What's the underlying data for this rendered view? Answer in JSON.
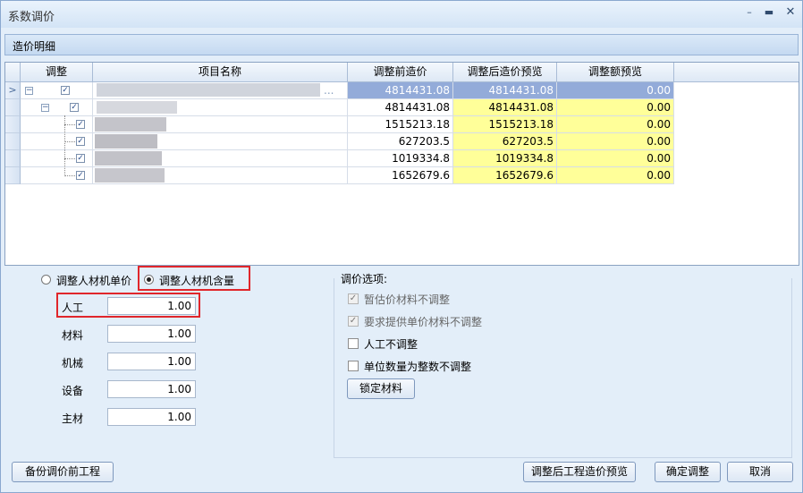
{
  "window": {
    "title": "系数调价"
  },
  "section_header": "造价明细",
  "grid": {
    "columns": [
      "调整",
      "项目名称",
      "调整前造价",
      "调整后造价预览",
      "调整额预览"
    ],
    "rows": [
      {
        "before": "4814431.08",
        "after": "4814431.08",
        "diff": "0.00",
        "name_tail": "..."
      },
      {
        "before": "4814431.08",
        "after": "4814431.08",
        "diff": "0.00"
      },
      {
        "before": "1515213.18",
        "after": "1515213.18",
        "diff": "0.00"
      },
      {
        "before": "627203.5",
        "after": "627203.5",
        "diff": "0.00"
      },
      {
        "before": "1019334.8",
        "after": "1019334.8",
        "diff": "0.00"
      },
      {
        "before": "1652679.6",
        "after": "1652679.6",
        "diff": "0.00"
      }
    ]
  },
  "adjust_mode": {
    "option_unit_price": "调整人材机单价",
    "option_content": "调整人材机含量",
    "selected": "调整人材机含量"
  },
  "coefficients": [
    {
      "label": "人工",
      "value": "1.00"
    },
    {
      "label": "材料",
      "value": "1.00"
    },
    {
      "label": "机械",
      "value": "1.00"
    },
    {
      "label": "设备",
      "value": "1.00"
    },
    {
      "label": "主材",
      "value": "1.00"
    }
  ],
  "options": {
    "title": "调价选项:",
    "items": [
      {
        "label": "暂估价材料不调整",
        "checked": true,
        "disabled": true
      },
      {
        "label": "要求提供单价材料不调整",
        "checked": true,
        "disabled": true
      },
      {
        "label": "人工不调整",
        "checked": false,
        "disabled": false
      },
      {
        "label": "单位数量为整数不调整",
        "checked": false,
        "disabled": false
      }
    ],
    "lock_button": "锁定材料"
  },
  "buttons": {
    "backup": "备份调价前工程",
    "preview": "调整后工程造价预览",
    "confirm": "确定调整",
    "cancel": "取消"
  }
}
